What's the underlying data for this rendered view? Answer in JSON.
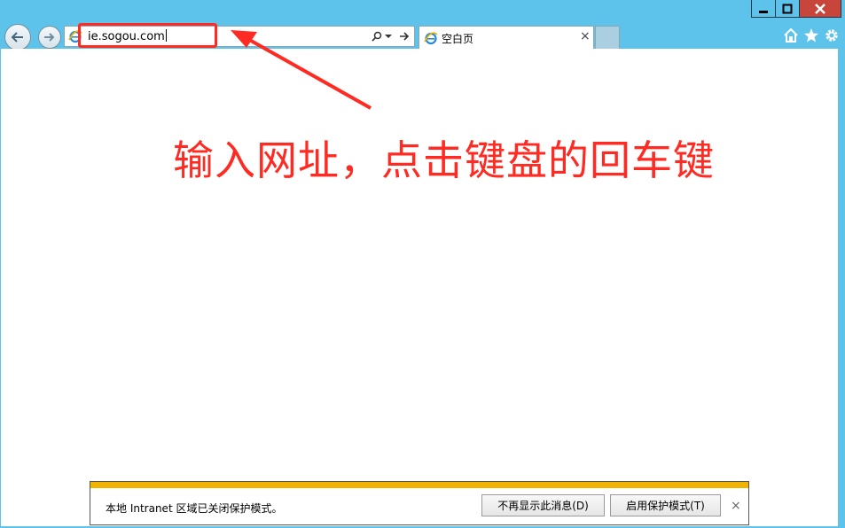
{
  "window": {
    "minimize_icon": "minimize-icon",
    "maximize_icon": "maximize-icon",
    "close_icon": "close-icon"
  },
  "nav": {
    "back_icon": "back-arrow-icon",
    "forward_icon": "forward-arrow-icon"
  },
  "address": {
    "value": "ie.sogou.com",
    "search_icon": "search-icon",
    "dropdown_icon": "dropdown-icon",
    "go_icon": "go-arrow-icon"
  },
  "tabs": [
    {
      "label": "空白页",
      "icon": "ie-icon",
      "close_label": "×"
    }
  ],
  "toolbar": {
    "home_icon": "home-icon",
    "favorites_icon": "star-icon",
    "tools_icon": "gear-icon"
  },
  "annotation": {
    "text": "输入网址，点击键盘的回车键",
    "color": "#ff2a22"
  },
  "info_bar": {
    "message": "本地 Intranet 区域已关闭保护模式。",
    "dont_show_label": "不再显示此消息(D)",
    "enable_label": "启用保护模式(T)",
    "close_label": "×",
    "accent_color": "#f0b400"
  }
}
